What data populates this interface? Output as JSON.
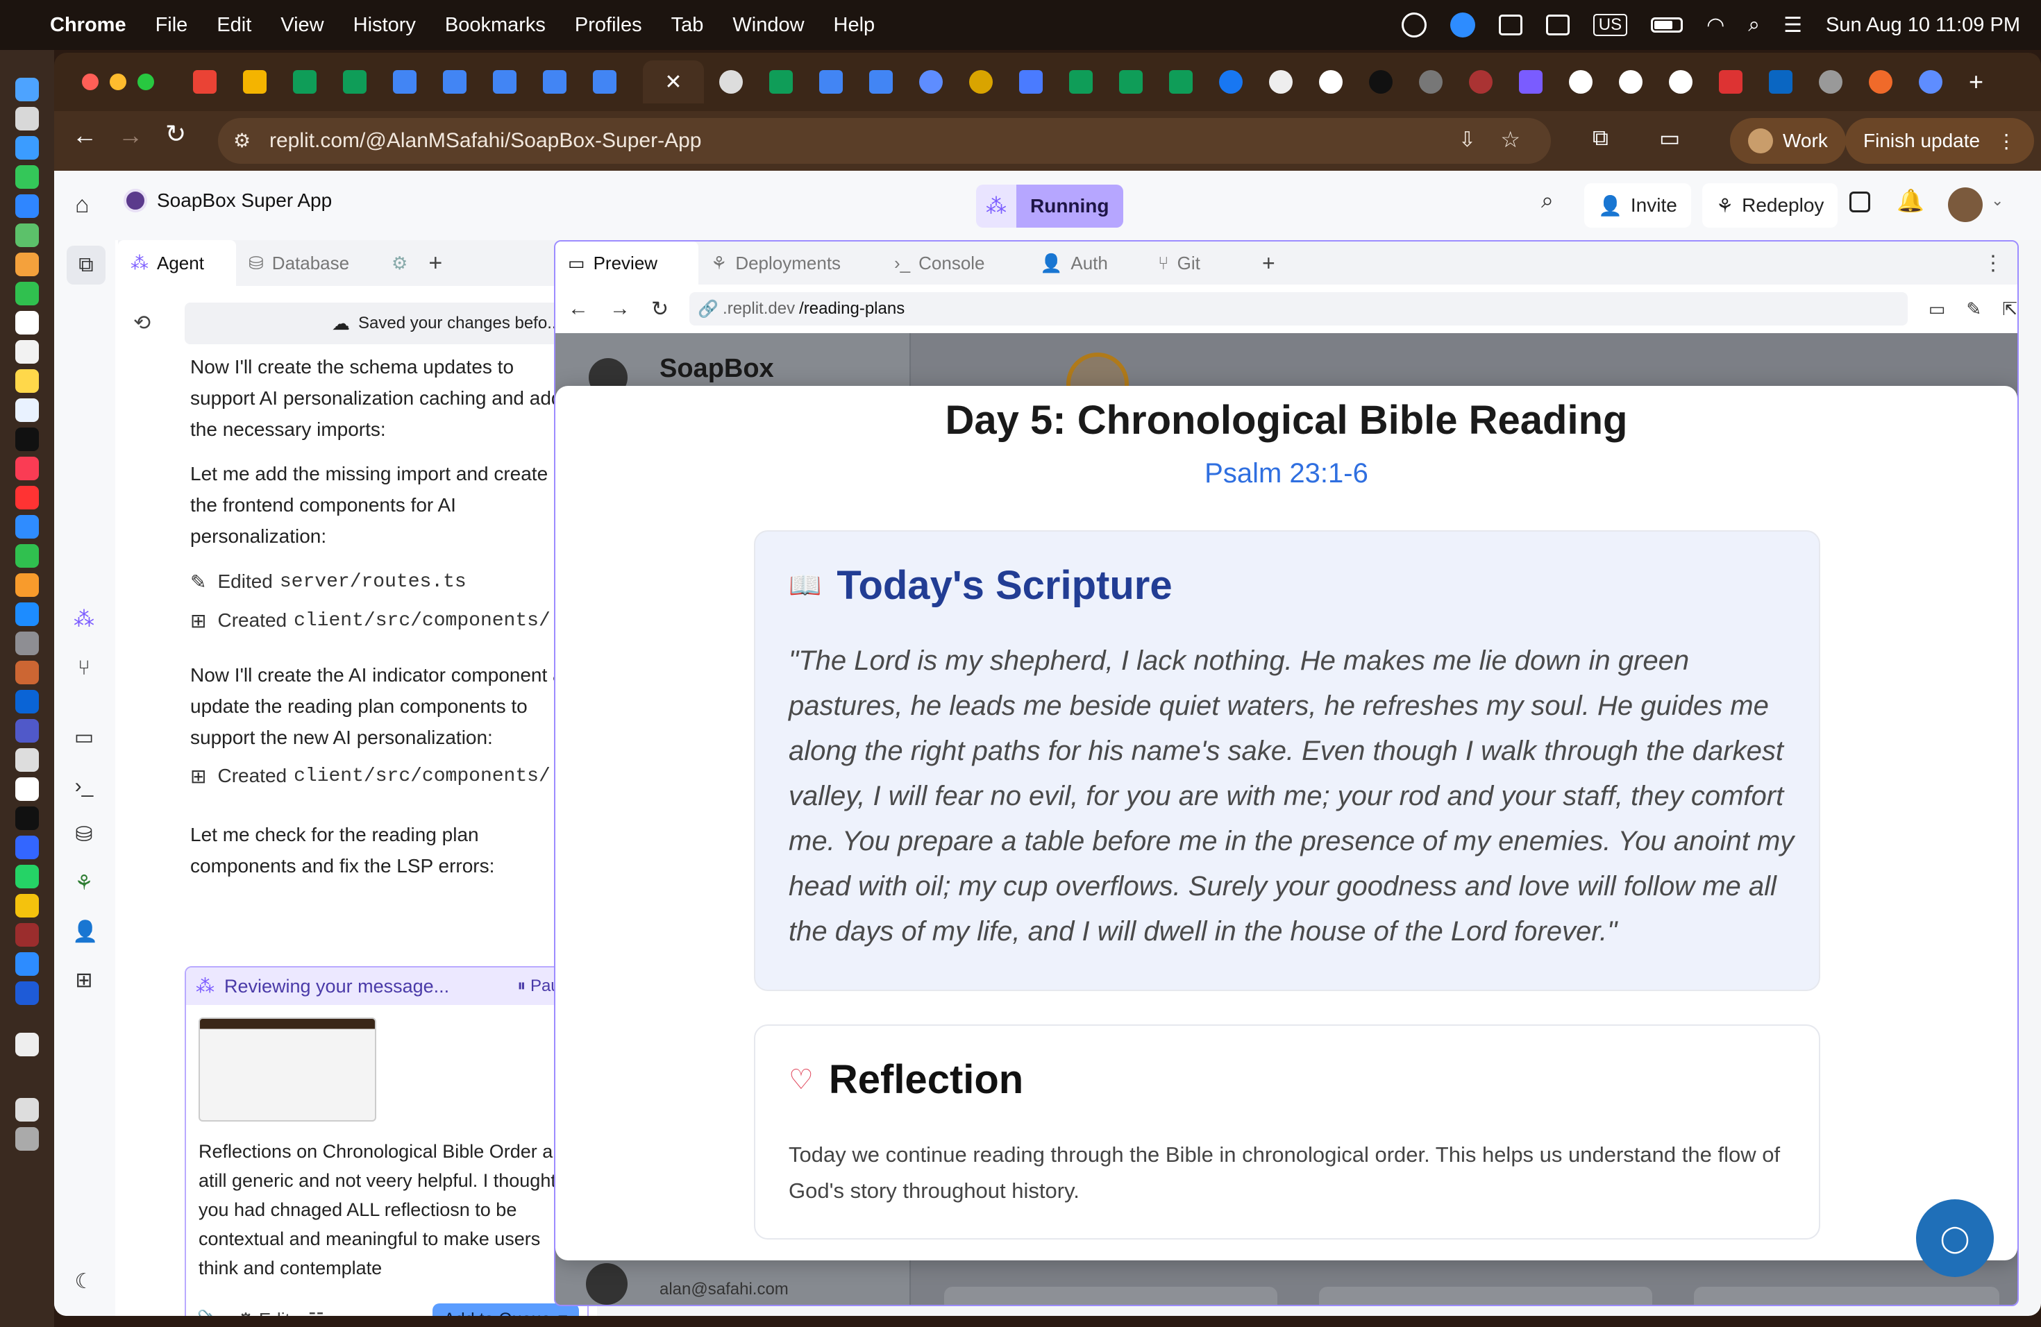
{
  "menubar": {
    "app": "Chrome",
    "items": [
      "File",
      "Edit",
      "View",
      "History",
      "Bookmarks",
      "Profiles",
      "Tab",
      "Window",
      "Help"
    ],
    "keyboard": "US",
    "datetime": "Sun Aug 10  11:09 PM"
  },
  "browser": {
    "url_host": "replit.com",
    "url_path": "/@AlanMSafahi/SoapBox-Super-App",
    "profile": "Work",
    "finish_update": "Finish update"
  },
  "replit": {
    "project": "SoapBox Super App",
    "status": "Running",
    "invite": "Invite",
    "redeploy": "Redeploy",
    "left_tabs": [
      "Agent",
      "Database"
    ],
    "history_text": "Saved your changes befo...",
    "messages": [
      "Now I'll create the schema updates to support AI personalization caching and add the necessary imports:",
      "Let me add the missing import and create the frontend components for AI personalization:",
      "Now I'll create the AI indicator component and update the reading plan components to support the new AI personalization:",
      "Let me check for the reading plan components and fix the LSP errors:"
    ],
    "files": [
      {
        "verb": "Edited",
        "path": "server/routes.ts"
      },
      {
        "verb": "Created",
        "path": "client/src/components/..."
      },
      {
        "verb": "Created",
        "path": "client/src/components/..."
      }
    ],
    "reviewing": "Reviewing your message...",
    "pause": "Pause",
    "user_message": "Reflections on Chronological Bible Order are atill generic and not veery helpful. I thought you had chnaged ALL reflectiosn to be contextual and meaningful to make users think and contemplate",
    "edit": "Edit",
    "add_to_queue": "Add to Queue",
    "work_tabs": [
      "Preview",
      "Deployments",
      "Console",
      "Auth",
      "Git"
    ],
    "preview_url_host": ".replit.dev",
    "preview_url_path": "/reading-plans",
    "bg_brand": "SoapBox",
    "bg_email": "alan@safahi.com"
  },
  "reading": {
    "title": "Day 5: Chronological Bible Reading",
    "reference": "Psalm 23:1-6",
    "scripture_heading": "Today's Scripture",
    "scripture": "\"The Lord is my shepherd, I lack nothing. He makes me lie down in green pastures, he leads me beside quiet waters, he refreshes my soul. He guides me along the right paths for his name's sake. Even though I walk through the darkest valley, I will fear no evil, for you are with me; your rod and your staff, they comfort me. You prepare a table before me in the presence of my enemies. You anoint my head with oil; my cup overflows. Surely your goodness and love will follow me all the days of my life, and I will dwell in the house of the Lord forever.\"",
    "reflection_heading": "Reflection",
    "reflection": "Today we continue reading through the Bible in chronological order. This helps us understand the flow of God's story throughout history."
  },
  "colors": {
    "accent": "#2f6fe0",
    "agent_purple": "#7b5cff",
    "heart": "#e0455a"
  }
}
